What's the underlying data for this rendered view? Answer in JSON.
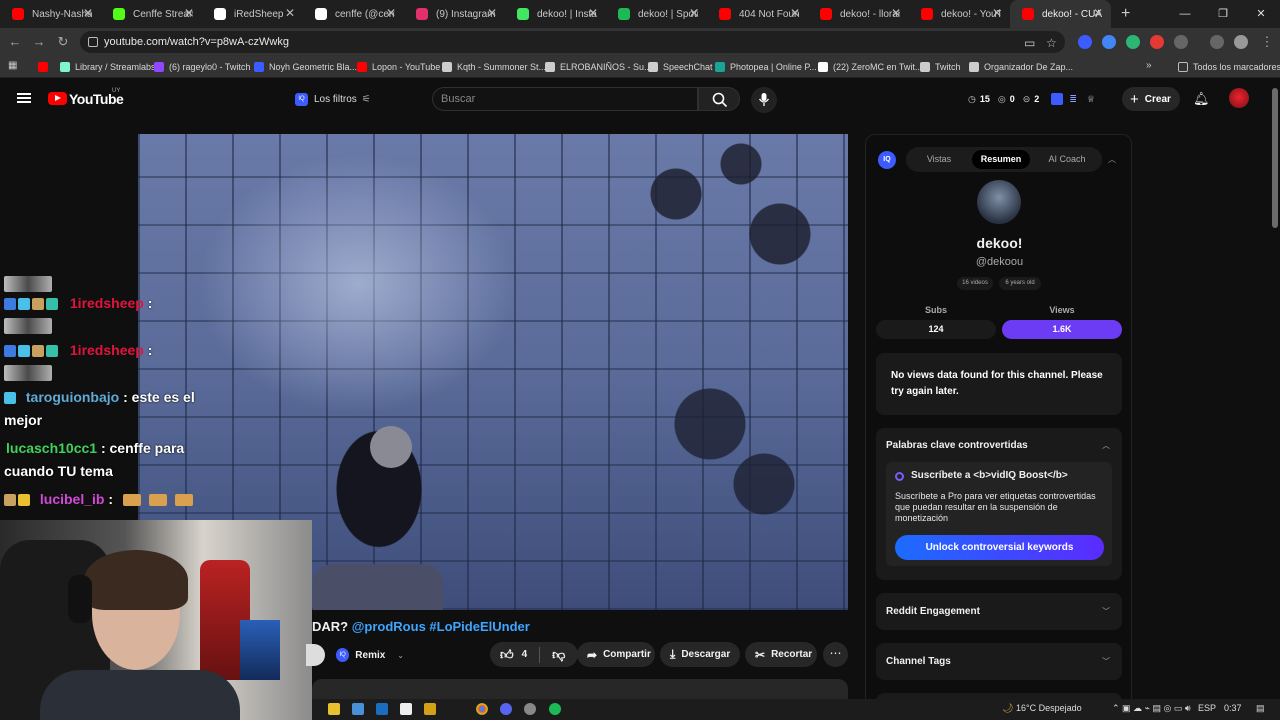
{
  "browser": {
    "tabs": [
      {
        "label": "Nashy-Nashai",
        "icon": "youtube-icon",
        "color": "#ff0000"
      },
      {
        "label": "Cenffe Stream",
        "icon": "kick-icon",
        "color": "#53fc18"
      },
      {
        "label": "iRedSheep",
        "icon": "x-icon",
        "color": "#ffffff"
      },
      {
        "label": "cenffe (@cenff",
        "icon": "x-icon",
        "color": "#ffffff"
      },
      {
        "label": "(9) Instagram",
        "icon": "instagram-icon",
        "color": "#e1306c"
      },
      {
        "label": "dekoo! | Instag",
        "icon": "linktree-icon",
        "color": "#43e660"
      },
      {
        "label": "dekoo! | Spotif",
        "icon": "spotify-icon",
        "color": "#1db954"
      },
      {
        "label": "404 Not Found",
        "icon": "youtube-icon",
        "color": "#ff0000"
      },
      {
        "label": "dekoo! - lloran",
        "icon": "youtube-icon",
        "color": "#ff0000"
      },
      {
        "label": "dekoo! - YouTu",
        "icon": "youtube-icon",
        "color": "#ff0000"
      },
      {
        "label": "dekoo! - CUÁN",
        "icon": "youtube-icon",
        "color": "#ff0000"
      }
    ],
    "url": "youtube.com/watch?v=p8wA-czWwkg",
    "bookmarks": [
      {
        "label": "",
        "color": "#ff0000"
      },
      {
        "label": "Library / Streamlabs",
        "color": "#80f5d2"
      },
      {
        "label": "(6) rageylo0 - Twitch",
        "color": "#9146ff"
      },
      {
        "label": "Noyh Geometric Bla...",
        "color": "#3d5cff"
      },
      {
        "label": "Lopon - YouTube",
        "color": "#ff0000"
      },
      {
        "label": "Kqth - Summoner St...",
        "color": "#cccccc"
      },
      {
        "label": "ELROBANIÑOS - Su...",
        "color": "#cccccc"
      },
      {
        "label": "SpeechChat",
        "color": "#cccccc"
      },
      {
        "label": "Photopea | Online P...",
        "color": "#18a497"
      },
      {
        "label": "(22) ZeroMC en Twit...",
        "color": "#ffffff"
      },
      {
        "label": "Twitch",
        "color": "#cccccc"
      },
      {
        "label": "Organizador De Zap...",
        "color": "#cccccc"
      }
    ],
    "all_bookmarks": "Todos los marcadores"
  },
  "youtube": {
    "logo_text": "YouTube",
    "country": "UY",
    "filters_label": "Los filtros",
    "search_placeholder": "Buscar",
    "stats": {
      "a": "15",
      "b": "0",
      "c": "2"
    },
    "create_label": "Crear"
  },
  "chat": {
    "messages": [
      {
        "user": "1iredsheep",
        "text": ":",
        "color": "#e0143c"
      },
      {
        "user": "1iredsheep",
        "text": ":",
        "color": "#e0143c"
      },
      {
        "user": "taroguionbajo",
        "text": ": este es el",
        "cont": "mejor",
        "color": "#5fa9d6"
      },
      {
        "user": "lucasch10cc1",
        "text": ": cenffe para",
        "cont": "cuando TU tema",
        "color": "#3fd15a"
      },
      {
        "user": "lucibel_ib",
        "text": ":",
        "color": "#d14ad6"
      }
    ]
  },
  "video": {
    "title_fragment": "DAR?",
    "tags": "@prodRous #LoPideElUnder",
    "remix_label": "Remix",
    "likes": "4",
    "share_label": "Compartir",
    "download_label": "Descargar",
    "clip_label": "Recortar"
  },
  "vidiq": {
    "logo": "IQ",
    "tabs": [
      "Vistas",
      "Resumen",
      "AI Coach"
    ],
    "channel_name": "dekoo!",
    "handle": "@dekoou",
    "videos": "16 videos",
    "age": "6 years old",
    "subs_label": "Subs",
    "subs_value": "124",
    "views_label": "Views",
    "views_value": "1.6K",
    "no_views_msg": "No views data found for this channel. Please try again later.",
    "keywords_title": "Palabras clave controvertidas",
    "keywords_sub": "Suscríbete a <b>vidIQ Boost</b>",
    "keywords_desc": "Suscríbete a Pro para ver etiquetas controvertidas que puedan resultar en la suspensión de monetización",
    "keywords_btn": "Unlock controversial keywords",
    "reddit_title": "Reddit Engagement",
    "tags_title": "Channel Tags",
    "accent": "#6c3cf5"
  },
  "taskbar": {
    "weather": "16°C Despejado",
    "lang": "ESP",
    "time": "0:37"
  }
}
